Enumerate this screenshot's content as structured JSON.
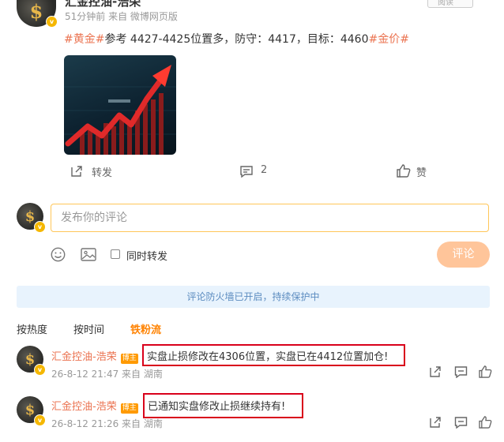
{
  "post": {
    "author_name": "汇金控油-浩荣",
    "meta": "51分钟前 来自 微博网页版",
    "follow_label": "阅读",
    "content_tag1": "#黄金#",
    "content_main": "参考 4427-4425位置多，防守：4417，目标：4460",
    "content_tag2": "#金价#",
    "actions": {
      "repost_label": "转发",
      "comment_count": "2",
      "like_label": "赞"
    }
  },
  "composer": {
    "placeholder": "发布你的评论",
    "repost_option_label": "同时转发",
    "submit_label": "评论"
  },
  "firewall_notice": "评论防火墙已开启，持续保护中",
  "sort_tabs": [
    {
      "label": "按热度",
      "active": false
    },
    {
      "label": "按时间",
      "active": false
    },
    {
      "label": "铁粉流",
      "active": true
    }
  ],
  "comments": [
    {
      "author": "汇金控油-浩荣",
      "role_tag": "博主",
      "text": "实盘止损修改在4306位置，实盘已在4412位置加仓!",
      "meta": "26-8-12 21:47 来自 湖南"
    },
    {
      "author": "汇金控油-浩荣",
      "role_tag": "博主",
      "text": "已通知实盘修改止损继续持有!",
      "meta": "26-8-12 21:26 来自 湖南"
    }
  ],
  "colors": {
    "accent_orange": "#ff8200",
    "hashtag": "#eb7350",
    "highlight_box": "#d9001b",
    "firewall_bg": "#e8f3fd"
  }
}
